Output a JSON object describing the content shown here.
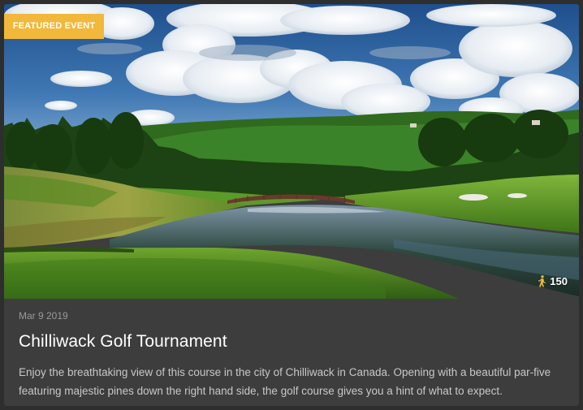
{
  "event": {
    "badge": "FEATURED EVENT",
    "attendance_count": "150",
    "attendance_icon": "walking-person-icon",
    "date": "Mar 9 2019",
    "title": "Chilliwack Golf Tournament",
    "description": "Enjoy the breathtaking view of this course in the city of Chilliwack in Canada. Opening with a beautiful par-five featuring majestic pines down the right hand side, the golf course gives you a hint of what to expect."
  },
  "colors": {
    "badge": "#f2b83b",
    "card_background": "#3d3d3d",
    "page_background": "#2e2e2e",
    "attendance_icon": "#f2b83b"
  }
}
